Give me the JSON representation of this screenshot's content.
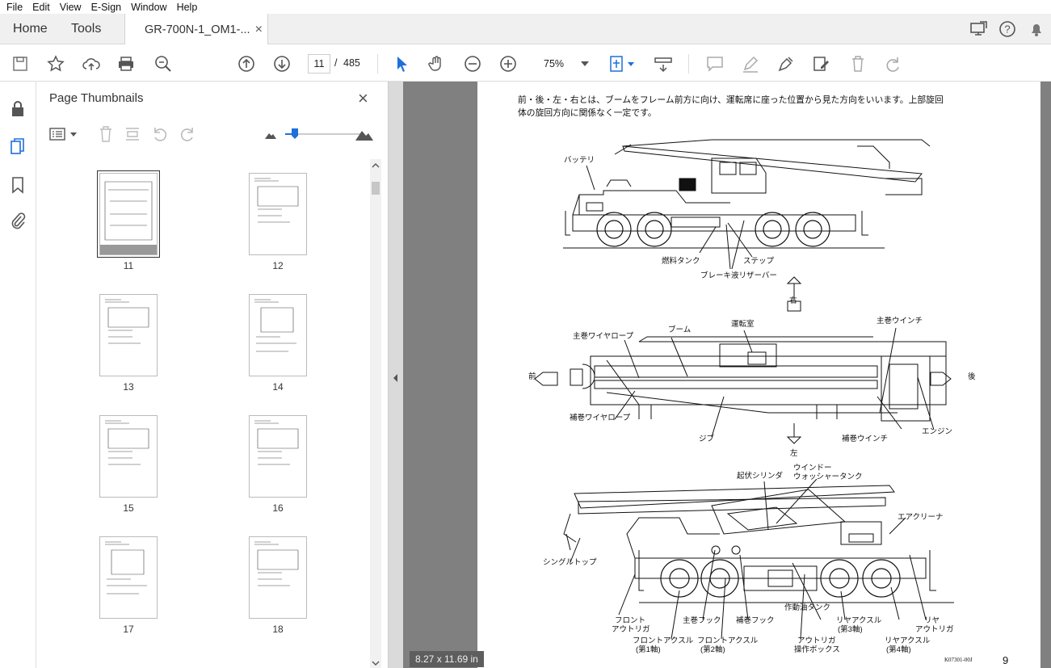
{
  "menu": [
    "File",
    "Edit",
    "View",
    "E-Sign",
    "Window",
    "Help"
  ],
  "tabs": {
    "home": "Home",
    "tools": "Tools",
    "document": "GR-700N-1_OM1-...",
    "close": "×"
  },
  "toolbar": {
    "current_page": "11",
    "page_sep": "/",
    "total_pages": "485",
    "zoom": "75%"
  },
  "panel": {
    "title": "Page Thumbnails",
    "close": "×"
  },
  "thumbnails": [
    "11",
    "12",
    "13",
    "14",
    "15",
    "16",
    "17",
    "18"
  ],
  "page_size": "8.27 x 11.69 in",
  "document": {
    "intro_line1": "前・後・左・右とは、ブームをフレーム前方に向け、運転席に座った位置から見た方向をいいます。上部旋回",
    "intro_line2": "体の旋回方向に関係なく一定です。",
    "side_view_labels": {
      "battery": "バッテリ",
      "fuel_tank": "燃料タンク",
      "step": "ステップ",
      "brake_reservoir": "ブレーキ液リザーバー"
    },
    "top_view_labels": {
      "right": "右",
      "left": "左",
      "front": "前",
      "rear": "後",
      "main_wire": "主巻ワイヤロープ",
      "boom": "ブーム",
      "cab": "運転室",
      "main_winch": "主巻ウインチ",
      "aux_wire": "補巻ワイヤロープ",
      "jib": "ジブ",
      "aux_winch": "補巻ウインチ",
      "engine": "エンジン"
    },
    "rear_view_labels": {
      "derrick_cyl": "起伏シリンダ",
      "washer_tank_1": "ウインドー",
      "washer_tank_2": "ウォッシャータンク",
      "air_cleaner": "エアクリーナ",
      "single_top": "シングルトップ",
      "front_outrigger_1": "フロント",
      "front_outrigger_2": "アウトリガ",
      "main_hook": "主巻フック",
      "aux_hook": "補巻フック",
      "hydraulic_tank": "作動油タンク",
      "rear_axle_3_1": "リヤアクスル",
      "rear_axle_3_2": "(第3軸)",
      "rear_outrigger_1": "リヤ",
      "rear_outrigger_2": "アウトリガ",
      "front_axle_1_1": "フロントアクスル",
      "front_axle_1_2": "(第1軸)",
      "front_axle_2_1": "フロントアクスル",
      "front_axle_2_2": "(第2軸)",
      "outrigger_box_1": "アウトリガ",
      "outrigger_box_2": "操作ボックス",
      "rear_axle_4_1": "リヤアクスル",
      "rear_axle_4_2": "(第4軸)"
    },
    "figure_code": "K07301-00J",
    "page_number": "9"
  }
}
